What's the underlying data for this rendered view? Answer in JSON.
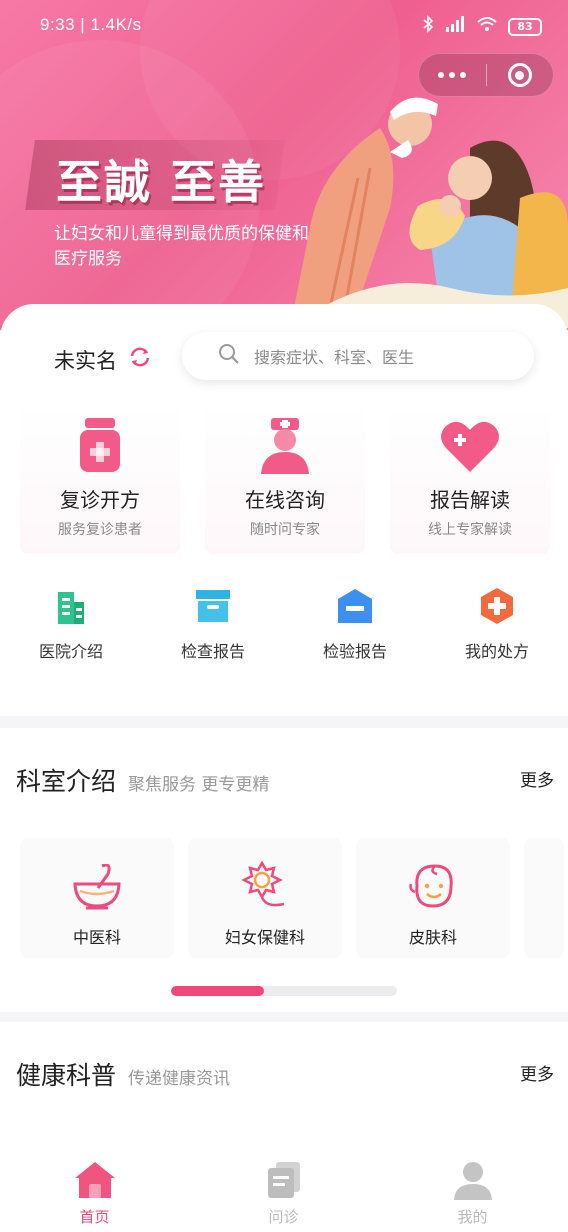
{
  "status_bar": {
    "time_speed": "9:33 | 1.4K/s",
    "battery": "83"
  },
  "banner": {
    "slogan": "至誠 至善",
    "subtitle": "让妇女和儿童得到最优质的保健和医疗服务"
  },
  "main": {
    "user_status": "未实名",
    "search_placeholder": "搜索症状、科室、医生",
    "services": [
      {
        "title": "复诊开方",
        "subtitle": "服务复诊患者"
      },
      {
        "title": "在线咨询",
        "subtitle": "随时问专家"
      },
      {
        "title": "报告解读",
        "subtitle": "线上专家解读"
      }
    ],
    "quick_links": [
      {
        "label": "医院介绍"
      },
      {
        "label": "检查报告"
      },
      {
        "label": "检验报告"
      },
      {
        "label": "我的处方"
      }
    ]
  },
  "departments": {
    "title": "科室介绍",
    "subtitle": "聚焦服务 更专更精",
    "more": "更多",
    "items": [
      {
        "label": "中医科"
      },
      {
        "label": "妇女保健科"
      },
      {
        "label": "皮肤科"
      }
    ],
    "scroll_progress": 0.41
  },
  "health": {
    "title": "健康科普",
    "subtitle": "传递健康资讯",
    "more": "更多"
  },
  "tabbar": {
    "tabs": [
      {
        "label": "首页",
        "active": true
      },
      {
        "label": "问诊",
        "active": false
      },
      {
        "label": "我的",
        "active": false
      }
    ]
  },
  "colors": {
    "brand": "#ef4a7d",
    "banner_pink": "#f779a6",
    "muted": "#999999"
  }
}
